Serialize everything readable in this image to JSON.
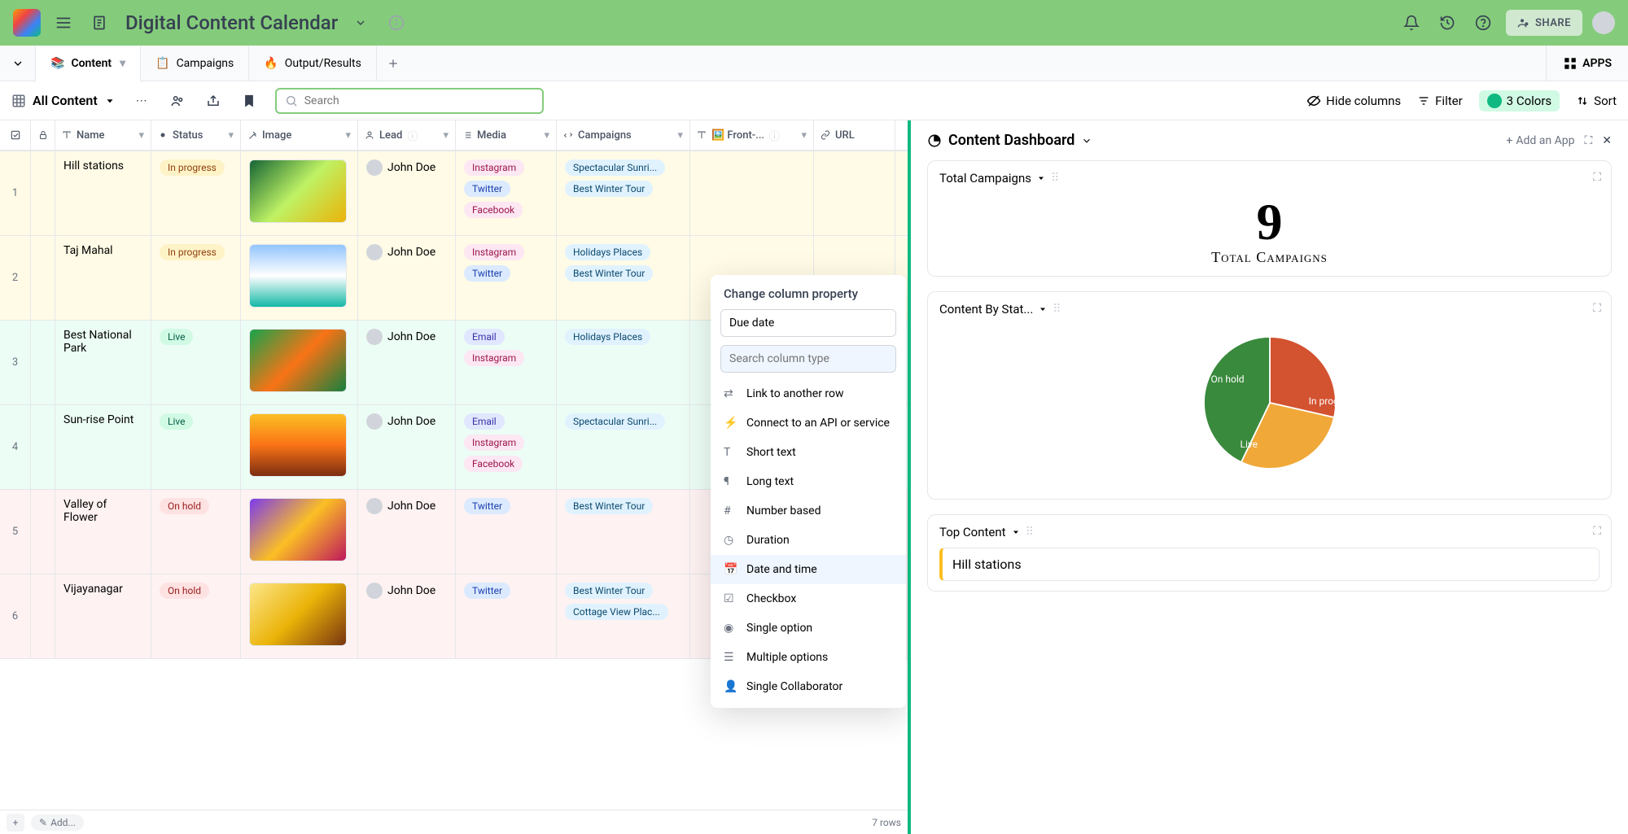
{
  "header": {
    "title": "Digital Content Calendar",
    "share": "SHARE"
  },
  "tabs": [
    {
      "emoji": "📚",
      "label": "Content",
      "active": true,
      "hasDropdown": true
    },
    {
      "emoji": "📋",
      "label": "Campaigns"
    },
    {
      "emoji": "🔥",
      "label": "Output/Results"
    }
  ],
  "apps_label": "APPS",
  "view": {
    "name": "All Content",
    "search_placeholder": "Search",
    "hide_columns": "Hide columns",
    "filter": "Filter",
    "colors": "3 Colors",
    "sort": "Sort"
  },
  "columns": [
    "Name",
    "Status",
    "Image",
    "Lead",
    "Media",
    "Campaigns",
    "🖼️ Front-...",
    "URL"
  ],
  "rows": [
    {
      "num": "1",
      "name": "Hill stations",
      "status": "In progress",
      "lead": "John Doe",
      "media": [
        "Instagram",
        "Twitter",
        "Facebook"
      ],
      "camp": [
        "Spectacular Sunri...",
        "Best Winter Tour"
      ],
      "thumb": "thumb-1"
    },
    {
      "num": "2",
      "name": "Taj Mahal",
      "status": "In progress",
      "lead": "John Doe",
      "media": [
        "Instagram",
        "Twitter"
      ],
      "camp": [
        "Holidays Places",
        "Best Winter Tour"
      ],
      "thumb": "thumb-2"
    },
    {
      "num": "3",
      "name": "Best National Park",
      "status": "Live",
      "lead": "John Doe",
      "media": [
        "Email",
        "Instagram"
      ],
      "camp": [
        "Holidays Places"
      ],
      "thumb": "thumb-3"
    },
    {
      "num": "4",
      "name": "Sun-rise Point",
      "status": "Live",
      "lead": "John Doe",
      "media": [
        "Email",
        "Instagram",
        "Facebook"
      ],
      "camp": [
        "Spectacular Sunri..."
      ],
      "thumb": "thumb-4"
    },
    {
      "num": "5",
      "name": "Valley of Flower",
      "status": "On hold",
      "lead": "John Doe",
      "media": [
        "Twitter"
      ],
      "camp": [
        "Best Winter Tour"
      ],
      "thumb": "thumb-5"
    },
    {
      "num": "6",
      "name": "Vijayanagar",
      "status": "On hold",
      "lead": "John Doe",
      "media": [
        "Twitter"
      ],
      "camp": [
        "Best Winter Tour",
        "Cottage View Plac..."
      ],
      "thumb": "thumb-6"
    }
  ],
  "footer": {
    "add": "Add...",
    "rows": "7 rows"
  },
  "popover": {
    "title": "Change column property",
    "input_value": "Due date",
    "search_placeholder": "Search column type",
    "items": [
      "Link to another row",
      "Connect to an API or service",
      "Short text",
      "Long text",
      "Number based",
      "Duration",
      "Date and time",
      "Checkbox",
      "Single option",
      "Multiple options",
      "Single Collaborator"
    ],
    "selected": "Date and time"
  },
  "panel": {
    "title": "Content Dashboard",
    "add_app": "Add an App",
    "cards": {
      "total": {
        "title": "Total Campaigns",
        "value": "9",
        "label": "Total Campaigns"
      },
      "status": {
        "title": "Content By Stat...",
        "on_hold": "On hold",
        "in_progress": "In progress",
        "live": "Live"
      },
      "top": {
        "title": "Top Content",
        "item": "Hill stations"
      }
    }
  },
  "chart_data": {
    "type": "pie",
    "title": "Content By Status",
    "series": [
      {
        "name": "In progress",
        "value": 2,
        "color": "#d35230"
      },
      {
        "name": "Live",
        "value": 2,
        "color": "#f0a838"
      },
      {
        "name": "On hold",
        "value": 3,
        "color": "#3a8a3d"
      }
    ]
  }
}
